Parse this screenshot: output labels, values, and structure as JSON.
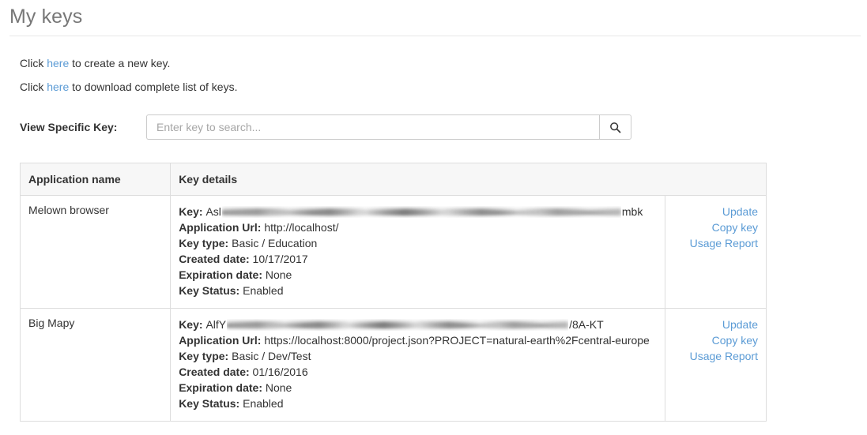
{
  "page": {
    "title": "My keys"
  },
  "intro": {
    "line1": {
      "before": "Click ",
      "link": "here",
      "after": " to create a new key."
    },
    "line2": {
      "before": "Click ",
      "link": "here",
      "after": " to download complete list of keys."
    }
  },
  "search": {
    "label": "View Specific Key:",
    "placeholder": "Enter key to search...",
    "value": "",
    "button_icon": "search-icon"
  },
  "table": {
    "columns": [
      "Application name",
      "Key details"
    ],
    "labels": {
      "key": "Key:",
      "application_url": "Application Url:",
      "key_type": "Key type:",
      "created_date": "Created date:",
      "expiration_date": "Expiration date:",
      "key_status": "Key Status:"
    },
    "rows": [
      {
        "application_name": "Melown browser",
        "key_prefix": "Asl",
        "key_redacted": true,
        "key_suffix": "mbk",
        "application_url": "http://localhost/",
        "key_type": "Basic / Education",
        "created_date": "10/17/2017",
        "expiration_date": "None",
        "key_status": "Enabled",
        "actions": [
          "Update",
          "Copy key",
          "Usage Report"
        ]
      },
      {
        "application_name": "Big Mapy",
        "key_prefix": "AlfY",
        "key_redacted": true,
        "key_suffix": "/8A-KT",
        "application_url": "https://localhost:8000/project.json?PROJECT=natural-earth%2Fcentral-europe",
        "key_type": "Basic / Dev/Test",
        "created_date": "01/16/2016",
        "expiration_date": "None",
        "key_status": "Enabled",
        "actions": [
          "Update",
          "Copy key",
          "Usage Report"
        ]
      }
    ]
  },
  "colors": {
    "link": "#5b9bd5",
    "title": "#777777",
    "text": "#333333",
    "border": "#dddddd",
    "header_bg": "#f7f7f7"
  }
}
